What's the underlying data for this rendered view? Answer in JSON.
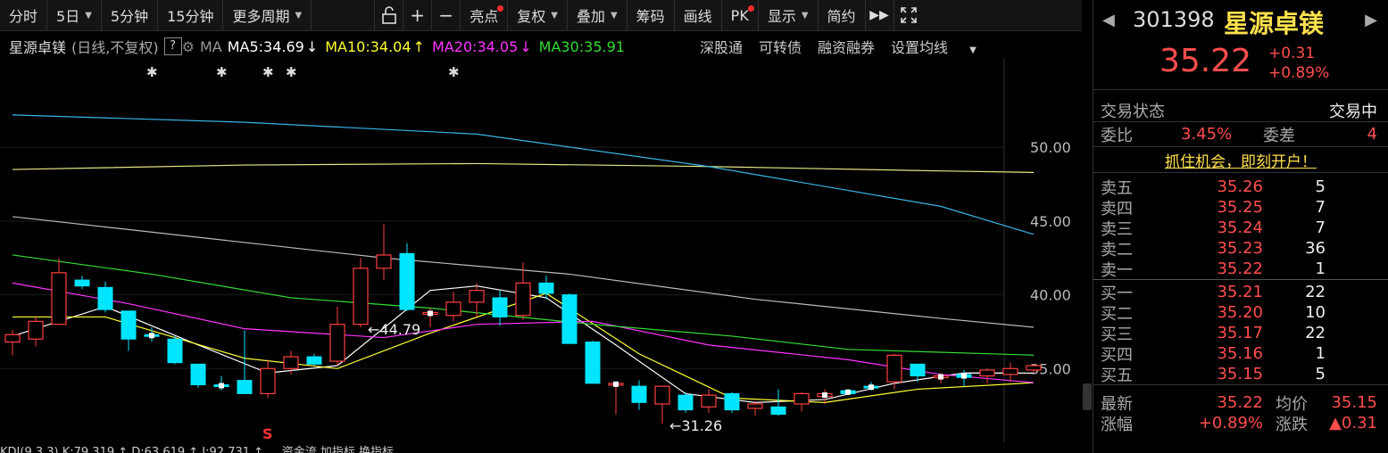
{
  "toolbar": {
    "items": [
      {
        "label": "分时",
        "dropdown": false,
        "dot": false
      },
      {
        "label": "5日",
        "dropdown": true,
        "dot": false
      },
      {
        "label": "5分钟",
        "dropdown": false,
        "dot": false
      },
      {
        "label": "15分钟",
        "dropdown": false,
        "dot": false
      },
      {
        "label": "更多周期",
        "dropdown": true,
        "dot": false
      }
    ],
    "tools": [
      {
        "label": "亮点",
        "dropdown": false,
        "dot": true
      },
      {
        "label": "复权",
        "dropdown": true,
        "dot": false
      },
      {
        "label": "叠加",
        "dropdown": true,
        "dot": false
      },
      {
        "label": "筹码",
        "dropdown": false,
        "dot": false
      },
      {
        "label": "画线",
        "dropdown": false,
        "dot": false
      },
      {
        "label": "PK",
        "dropdown": false,
        "dot": true
      },
      {
        "label": "显示",
        "dropdown": true,
        "dot": false
      },
      {
        "label": "简约",
        "dropdown": false,
        "dot": false
      }
    ],
    "lock_icon": "lock-icon",
    "plus_icon": "plus-icon",
    "minus_icon": "minus-icon",
    "forward_icon": "double-chevron-right-icon",
    "fullscreen_icon": "fullscreen-icon"
  },
  "legend": {
    "name": "星源卓镁",
    "mode": "(日线,不复权)",
    "help": "?",
    "ma": "MA",
    "ma5": "MA5:34.69",
    "ma5_arrow": "↓",
    "ma10": "MA10:34.04",
    "ma10_arrow": "↑",
    "ma20": "MA20:34.05",
    "ma20_arrow": "↓",
    "ma30": "MA30:35.91",
    "colors": {
      "ma5": "#ffffff",
      "ma10": "#ffff33",
      "ma20": "#ff33ff",
      "ma30": "#33dd33"
    }
  },
  "links": [
    "深股通",
    "可转债",
    "融资融券",
    "设置均线"
  ],
  "bottom_indicator": "KDJ(9,3,3) K:79.319 ↑ D:63.619 ↑ J:92.731 ↑   ... 资金流  加指标  换指标",
  "chart_data": {
    "type": "candlestick",
    "y_ticks": [
      "50.00",
      "45.00",
      "40.00",
      "35.00"
    ],
    "ylim": [
      30.0,
      56.0
    ],
    "annotations": [
      {
        "label": "44.79",
        "index": 15
      },
      {
        "label": "31.26",
        "index": 28
      }
    ],
    "marker_s": "S",
    "stars": [
      6,
      9,
      11,
      12,
      19
    ],
    "candles": [
      {
        "o": 36.8,
        "h": 37.6,
        "l": 35.9,
        "c": 37.3
      },
      {
        "o": 37.0,
        "h": 38.5,
        "l": 36.5,
        "c": 38.2
      },
      {
        "o": 38.0,
        "h": 42.5,
        "l": 38.0,
        "c": 41.5
      },
      {
        "o": 41.0,
        "h": 41.3,
        "l": 40.4,
        "c": 40.6
      },
      {
        "o": 40.5,
        "h": 40.9,
        "l": 38.8,
        "c": 39.0
      },
      {
        "o": 38.9,
        "h": 38.9,
        "l": 36.2,
        "c": 37.0
      },
      {
        "o": 37.3,
        "h": 37.8,
        "l": 36.8,
        "c": 37.2
      },
      {
        "o": 37.0,
        "h": 37.2,
        "l": 35.3,
        "c": 35.4
      },
      {
        "o": 35.3,
        "h": 35.3,
        "l": 33.7,
        "c": 33.9
      },
      {
        "o": 33.9,
        "h": 34.5,
        "l": 33.5,
        "c": 33.8
      },
      {
        "o": 34.2,
        "h": 37.6,
        "l": 33.3,
        "c": 33.3
      },
      {
        "o": 33.3,
        "h": 35.6,
        "l": 33.0,
        "c": 35.0
      },
      {
        "o": 35.0,
        "h": 36.2,
        "l": 34.6,
        "c": 35.8
      },
      {
        "o": 35.8,
        "h": 36.0,
        "l": 35.2,
        "c": 35.3
      },
      {
        "o": 35.5,
        "h": 39.2,
        "l": 35.2,
        "c": 38.0
      },
      {
        "o": 38.0,
        "h": 42.5,
        "l": 37.8,
        "c": 41.8
      },
      {
        "o": 41.8,
        "h": 44.79,
        "l": 41.0,
        "c": 42.7
      },
      {
        "o": 42.8,
        "h": 43.5,
        "l": 38.9,
        "c": 39.0
      },
      {
        "o": 38.8,
        "h": 39.1,
        "l": 37.8,
        "c": 38.8
      },
      {
        "o": 38.6,
        "h": 40.2,
        "l": 38.2,
        "c": 39.5
      },
      {
        "o": 39.5,
        "h": 40.8,
        "l": 38.5,
        "c": 40.3
      },
      {
        "o": 39.8,
        "h": 40.3,
        "l": 37.9,
        "c": 38.5
      },
      {
        "o": 38.6,
        "h": 42.2,
        "l": 38.3,
        "c": 40.8
      },
      {
        "o": 40.8,
        "h": 41.3,
        "l": 39.7,
        "c": 40.1
      },
      {
        "o": 40.0,
        "h": 40.1,
        "l": 36.8,
        "c": 36.7
      },
      {
        "o": 36.8,
        "h": 36.9,
        "l": 34.0,
        "c": 34.0
      },
      {
        "o": 34.0,
        "h": 34.0,
        "l": 31.9,
        "c": 34.0
      },
      {
        "o": 33.8,
        "h": 34.2,
        "l": 32.2,
        "c": 32.7
      },
      {
        "o": 32.6,
        "h": 33.8,
        "l": 31.26,
        "c": 33.8
      },
      {
        "o": 33.2,
        "h": 33.4,
        "l": 32.0,
        "c": 32.2
      },
      {
        "o": 32.4,
        "h": 33.6,
        "l": 32.0,
        "c": 33.2
      },
      {
        "o": 33.3,
        "h": 33.4,
        "l": 32.0,
        "c": 32.2
      },
      {
        "o": 32.3,
        "h": 32.8,
        "l": 31.8,
        "c": 32.6
      },
      {
        "o": 32.4,
        "h": 33.6,
        "l": 31.8,
        "c": 31.9
      },
      {
        "o": 32.6,
        "h": 33.4,
        "l": 32.1,
        "c": 33.3
      },
      {
        "o": 33.1,
        "h": 33.6,
        "l": 32.6,
        "c": 33.3
      },
      {
        "o": 33.5,
        "h": 33.6,
        "l": 33.2,
        "c": 33.3
      },
      {
        "o": 33.8,
        "h": 34.1,
        "l": 33.5,
        "c": 33.7
      },
      {
        "o": 34.1,
        "h": 36.0,
        "l": 33.6,
        "c": 35.9
      },
      {
        "o": 35.3,
        "h": 35.3,
        "l": 34.1,
        "c": 34.5
      },
      {
        "o": 34.5,
        "h": 34.7,
        "l": 34.0,
        "c": 34.5
      },
      {
        "o": 34.6,
        "h": 34.9,
        "l": 33.8,
        "c": 34.4
      },
      {
        "o": 34.5,
        "h": 35.0,
        "l": 34.0,
        "c": 34.9
      },
      {
        "o": 34.6,
        "h": 35.4,
        "l": 34.1,
        "c": 35.0
      },
      {
        "o": 34.9,
        "h": 35.3,
        "l": 34.7,
        "c": 35.2
      }
    ],
    "ma_lines": {
      "ma5": [
        [
          0,
          37.2
        ],
        [
          4,
          39.2
        ],
        [
          8,
          36.6
        ],
        [
          11,
          34.7
        ],
        [
          14,
          35.2
        ],
        [
          18,
          40.3
        ],
        [
          20,
          40.6
        ],
        [
          23,
          39.8
        ],
        [
          26,
          36.6
        ],
        [
          29,
          33.3
        ],
        [
          32,
          32.7
        ],
        [
          35,
          32.9
        ],
        [
          38,
          34.0
        ],
        [
          41,
          34.7
        ],
        [
          44,
          34.69
        ]
      ],
      "ma10": [
        [
          0,
          38.5
        ],
        [
          4,
          38.5
        ],
        [
          10,
          35.7
        ],
        [
          14,
          35.0
        ],
        [
          18,
          37.4
        ],
        [
          23,
          40.1
        ],
        [
          27,
          36.0
        ],
        [
          31,
          33.0
        ],
        [
          35,
          32.7
        ],
        [
          39,
          33.6
        ],
        [
          44,
          34.04
        ]
      ],
      "ma20": [
        [
          0,
          40.8
        ],
        [
          5,
          39.4
        ],
        [
          10,
          37.7
        ],
        [
          16,
          37.1
        ],
        [
          20,
          38.0
        ],
        [
          25,
          38.2
        ],
        [
          30,
          36.6
        ],
        [
          36,
          35.6
        ],
        [
          40,
          34.6
        ],
        [
          44,
          34.05
        ]
      ],
      "ma30": [
        [
          0,
          42.7
        ],
        [
          6,
          41.4
        ],
        [
          12,
          39.8
        ],
        [
          18,
          39.1
        ],
        [
          25,
          38.0
        ],
        [
          31,
          37.2
        ],
        [
          36,
          36.3
        ],
        [
          44,
          35.91
        ]
      ],
      "ma60": [
        [
          0,
          45.3
        ],
        [
          8,
          43.9
        ],
        [
          16,
          42.5
        ],
        [
          24,
          41.4
        ],
        [
          32,
          39.7
        ],
        [
          40,
          38.4
        ],
        [
          44,
          37.8
        ]
      ],
      "ma120": [
        [
          0,
          48.5
        ],
        [
          10,
          48.8
        ],
        [
          20,
          48.9
        ],
        [
          30,
          48.7
        ],
        [
          40,
          48.4
        ],
        [
          44,
          48.3
        ]
      ],
      "ma250": [
        [
          0,
          52.2
        ],
        [
          10,
          51.7
        ],
        [
          20,
          50.9
        ],
        [
          30,
          48.7
        ],
        [
          40,
          46.0
        ],
        [
          44,
          44.1
        ]
      ]
    }
  },
  "right_panel": {
    "code": "301398",
    "name": "星源卓镁",
    "price": "35.22",
    "change": "+0.31",
    "change_pct": "+0.89%",
    "status_label": "交易状态",
    "status_value": "交易中",
    "weibi_label": "委比",
    "weibi_value": "3.45%",
    "weicha_label": "委差",
    "weicha_value": "4",
    "promo": "抓住机会，即刻开户！",
    "sells": [
      {
        "label": "卖五",
        "price": "35.26",
        "vol": "5"
      },
      {
        "label": "卖四",
        "price": "35.25",
        "vol": "7"
      },
      {
        "label": "卖三",
        "price": "35.24",
        "vol": "7"
      },
      {
        "label": "卖二",
        "price": "35.23",
        "vol": "36"
      },
      {
        "label": "卖一",
        "price": "35.22",
        "vol": "1"
      }
    ],
    "buys": [
      {
        "label": "买一",
        "price": "35.21",
        "vol": "22"
      },
      {
        "label": "买二",
        "price": "35.20",
        "vol": "10"
      },
      {
        "label": "买三",
        "price": "35.17",
        "vol": "22"
      },
      {
        "label": "买四",
        "price": "35.16",
        "vol": "1"
      },
      {
        "label": "买五",
        "price": "35.15",
        "vol": "5"
      }
    ],
    "latest_label": "最新",
    "latest_value": "35.22",
    "avg_label": "均价",
    "avg_value": "35.15",
    "rise_label": "涨幅",
    "rise_value": "+0.89%",
    "diff_label": "涨跌",
    "diff_value": "▲0.31"
  }
}
